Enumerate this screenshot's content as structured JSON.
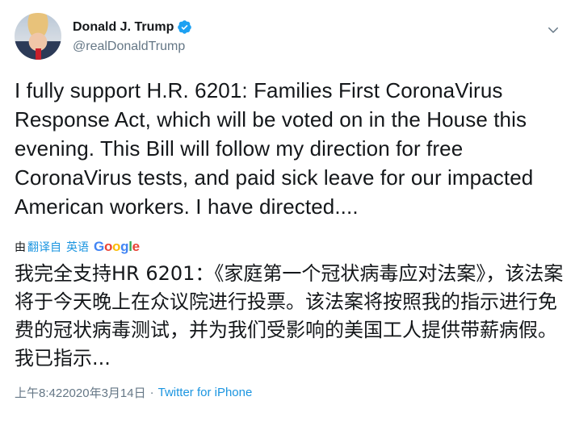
{
  "tweet": {
    "author": {
      "display_name": "Donald J. Trump",
      "handle": "@realDonaldTrump",
      "verified_icon": "verified-badge-icon",
      "avatar_icon": "profile-avatar"
    },
    "menu_icon": "chevron-down-icon",
    "text": "I fully support H.R. 6201: Families First CoronaVirus Response Act, which will be voted on in the House this evening. This Bill will follow my direction for free CoronaVirus tests, and paid sick leave for our impacted American workers. I have directed....",
    "translation": {
      "by_label": "由",
      "translate_link": "翻译自",
      "language": "英语",
      "provider": "Google",
      "text": "我完全支持HR 6201：《家庭第一个冠状病毒应对法案》，该法案将于今天晚上在众议院进行投票。该法案将按照我的指示进行免费的冠状病毒测试，并为我们受影响的美国工人提供带薪病假。我已指示..."
    },
    "meta": {
      "time": "上午8:42",
      "date": "2020年3月14日",
      "separator": "·",
      "source": "Twitter for iPhone"
    },
    "colors": {
      "accent": "#1b95e0",
      "secondary_text": "#657786",
      "primary_text": "#14171a"
    }
  }
}
